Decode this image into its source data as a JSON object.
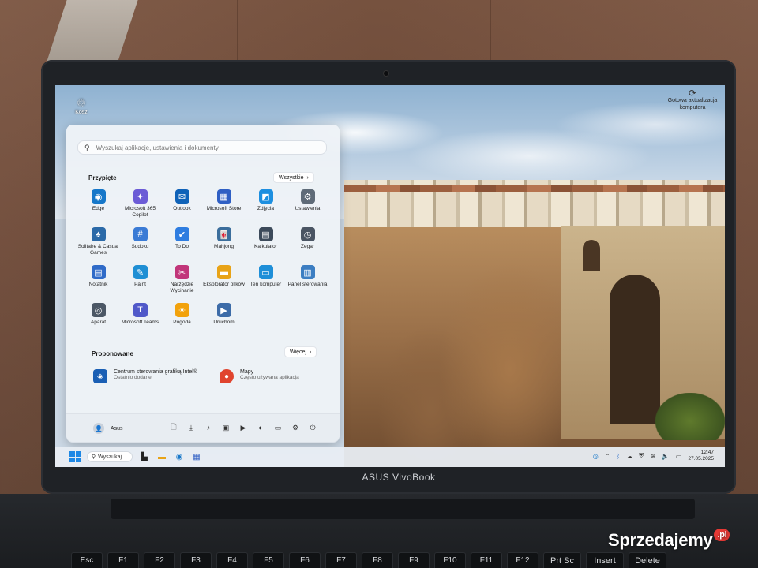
{
  "desktop": {
    "recycle_label": "Kosz",
    "activate_label": "Gotowa aktualizacja komputera"
  },
  "start_menu": {
    "search_placeholder": "Wyszukaj aplikacje, ustawienia i dokumenty",
    "pinned_title": "Przypięte",
    "all_button": "Wszystkie",
    "pinned_apps": [
      {
        "label": "Edge",
        "icon": "edge-icon",
        "color": "#1677c9"
      },
      {
        "label": "Microsoft 365 Copilot",
        "icon": "copilot-icon",
        "color": "#6b5bd6"
      },
      {
        "label": "Outlook",
        "icon": "outlook-icon",
        "color": "#0f62b8"
      },
      {
        "label": "Microsoft Store",
        "icon": "store-icon",
        "color": "#2f5fc4"
      },
      {
        "label": "Zdjęcia",
        "icon": "photos-icon",
        "color": "#1d8fe0"
      },
      {
        "label": "Ustawienia",
        "icon": "gear-icon",
        "color": "#5f6b78"
      },
      {
        "label": "Solitaire & Casual Games",
        "icon": "cards-icon",
        "color": "#2b6aa8"
      },
      {
        "label": "Sudoku",
        "icon": "sudoku-icon",
        "color": "#3a7bd5"
      },
      {
        "label": "To Do",
        "icon": "todo-icon",
        "color": "#2e7de0"
      },
      {
        "label": "Mahjong",
        "icon": "mahjong-icon",
        "color": "#3b6e9c"
      },
      {
        "label": "Kalkulator",
        "icon": "calculator-icon",
        "color": "#3c4a5a"
      },
      {
        "label": "Zegar",
        "icon": "clock-icon",
        "color": "#4a5563"
      },
      {
        "label": "Notatnik",
        "icon": "notepad-icon",
        "color": "#2f6bc8"
      },
      {
        "label": "Paint",
        "icon": "paint-icon",
        "color": "#1f8fd4"
      },
      {
        "label": "Narzędzie Wycinanie",
        "icon": "snipping-icon",
        "color": "#c1367a"
      },
      {
        "label": "Eksplorator plików",
        "icon": "folder-icon",
        "color": "#e8a317"
      },
      {
        "label": "Ten komputer",
        "icon": "computer-icon",
        "color": "#1e8fd8"
      },
      {
        "label": "Panel sterowania",
        "icon": "control-panel-icon",
        "color": "#3c7ec2"
      },
      {
        "label": "Aparat",
        "icon": "camera-icon",
        "color": "#4c5866"
      },
      {
        "label": "Microsoft Teams",
        "icon": "teams-icon",
        "color": "#5059c9"
      },
      {
        "label": "Pogoda",
        "icon": "weather-icon",
        "color": "#f2a20c"
      },
      {
        "label": "Uruchom",
        "icon": "run-icon",
        "color": "#3d6ca8"
      }
    ],
    "recommended_title": "Proponowane",
    "more_button": "Więcej",
    "recommended": [
      {
        "title": "Centrum sterowania grafiką Intel®",
        "subtitle": "Ostatnio dodane",
        "icon": "intel-graphics-icon",
        "color": "#1a5fb4"
      },
      {
        "title": "Mapy",
        "subtitle": "Często używana aplikacja",
        "icon": "maps-icon",
        "color": "#e0442e"
      }
    ],
    "user_name": "Asus"
  },
  "taskbar": {
    "search_label": "Wyszukaj",
    "time": "12:47",
    "date": "27.05.2025"
  },
  "laptop": {
    "brand": "ASUS VivoBook",
    "keys": [
      "Esc",
      "F1",
      "F2",
      "F3",
      "F4",
      "F5",
      "F6",
      "F7",
      "F8",
      "F9",
      "F10",
      "F11",
      "F12",
      "Prt Sc",
      "Insert",
      "Delete"
    ]
  },
  "watermark": {
    "text": "Sprzedajemy",
    "suffix": ".pl"
  }
}
